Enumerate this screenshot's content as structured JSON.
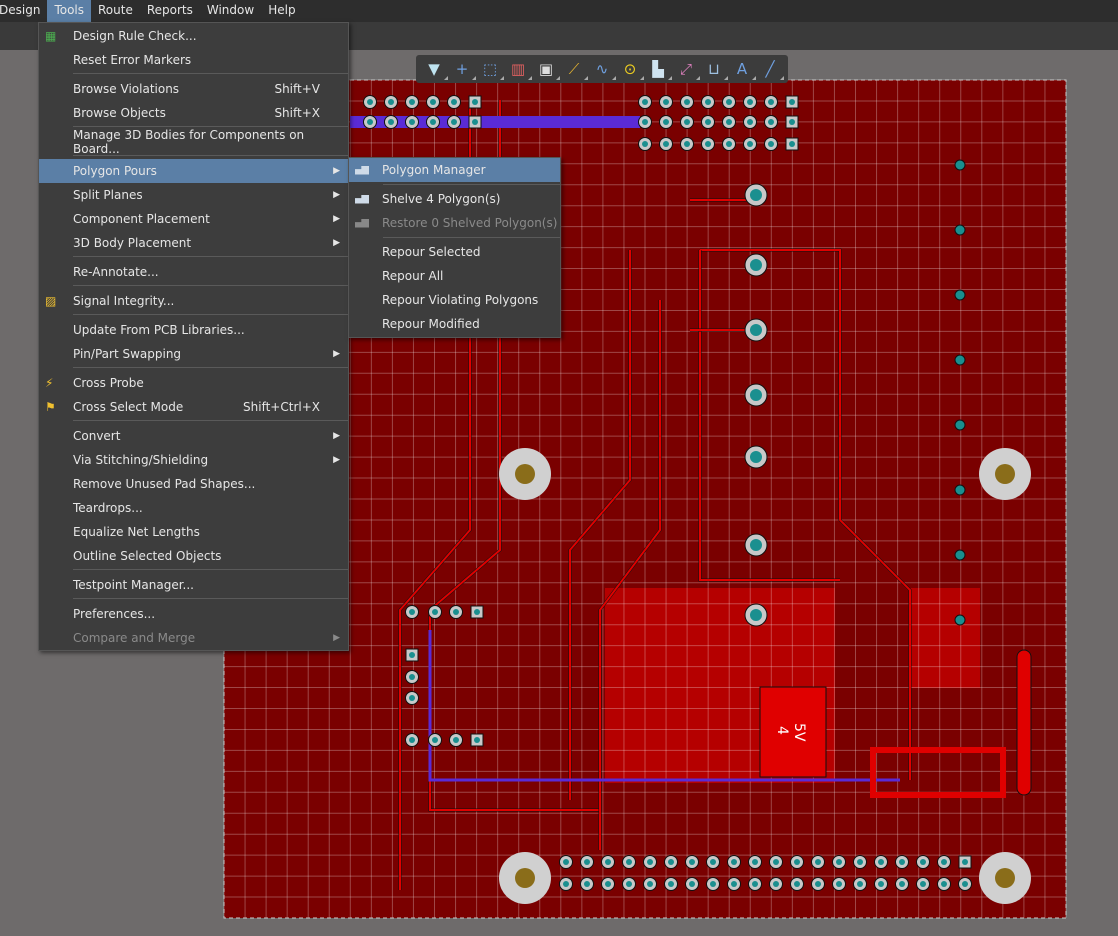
{
  "menubar": [
    "Design",
    "Tools",
    "Route",
    "Reports",
    "Window",
    "Help"
  ],
  "active_menu": "Tools",
  "toolbar": [
    "filter-icon",
    "crosshair-icon",
    "select-rect-icon",
    "align-icon",
    "component-icon",
    "route-icon",
    "interactive-diff-pair-icon",
    "via-icon",
    "polygon-icon",
    "net-icon",
    "dimension-icon",
    "text-icon",
    "line-icon"
  ],
  "menu": [
    {
      "label": "Design Rule Check...",
      "icon": "drc-icon"
    },
    {
      "label": "Reset Error Markers"
    },
    {
      "sep": true
    },
    {
      "label": "Browse Violations",
      "shortcut": "Shift+V"
    },
    {
      "label": "Browse Objects",
      "shortcut": "Shift+X"
    },
    {
      "sep": true
    },
    {
      "label": "Manage 3D Bodies for Components on Board..."
    },
    {
      "sep": true
    },
    {
      "label": "Polygon Pours",
      "submenu": true,
      "highlighted": true
    },
    {
      "label": "Split Planes",
      "submenu": true
    },
    {
      "label": "Component Placement",
      "submenu": true
    },
    {
      "label": "3D Body Placement",
      "submenu": true
    },
    {
      "sep": true
    },
    {
      "label": "Re-Annotate..."
    },
    {
      "sep": true
    },
    {
      "label": "Signal Integrity...",
      "icon": "signal-integrity-icon"
    },
    {
      "sep": true
    },
    {
      "label": "Update From PCB Libraries..."
    },
    {
      "label": "Pin/Part Swapping",
      "submenu": true
    },
    {
      "sep": true
    },
    {
      "label": "Cross Probe",
      "icon": "cross-probe-icon"
    },
    {
      "label": "Cross Select Mode",
      "shortcut": "Shift+Ctrl+X",
      "icon": "cross-select-icon"
    },
    {
      "sep": true
    },
    {
      "label": "Convert",
      "submenu": true
    },
    {
      "label": "Via Stitching/Shielding",
      "submenu": true
    },
    {
      "label": "Remove Unused Pad Shapes..."
    },
    {
      "label": "Teardrops..."
    },
    {
      "label": "Equalize Net Lengths"
    },
    {
      "label": "Outline Selected Objects"
    },
    {
      "sep": true
    },
    {
      "label": "Testpoint Manager..."
    },
    {
      "sep": true
    },
    {
      "label": "Preferences..."
    },
    {
      "label": "Compare and Merge",
      "submenu": true,
      "disabled": true
    }
  ],
  "submenu": [
    {
      "label": "Polygon Manager",
      "icon": "polygon-icon",
      "highlighted": true
    },
    {
      "sep": true
    },
    {
      "label": "Shelve 4 Polygon(s)",
      "icon": "polygon-icon"
    },
    {
      "label": "Restore 0 Shelved Polygon(s)",
      "icon": "polygon-icon",
      "disabled": true
    },
    {
      "sep": true
    },
    {
      "label": "Repour Selected"
    },
    {
      "label": "Repour All"
    },
    {
      "label": "Repour Violating Polygons"
    },
    {
      "label": "Repour Modified"
    }
  ],
  "board": {
    "component_label_1": "4",
    "component_label_2": "5V",
    "colors": {
      "board": "#7a0000",
      "copper": "#e00000",
      "pour": "#b50000",
      "pad": "#c8c8c8",
      "hole": "#1a8f8f",
      "trace_bottom": "#5a2bd6"
    }
  }
}
